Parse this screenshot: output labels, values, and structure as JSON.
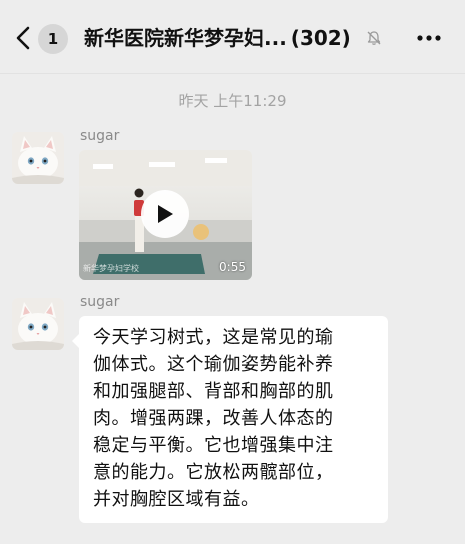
{
  "header": {
    "unread_count": "1",
    "title": "新华医院新华梦孕妇...",
    "member_count": "(302)"
  },
  "timestamp": "昨天 上午11:29",
  "messages": [
    {
      "type": "video",
      "sender": "sugar",
      "duration": "0:55",
      "watermark": "新华梦孕妇学校"
    },
    {
      "type": "text",
      "sender": "sugar",
      "lines": [
        "今天学习树式，这是常见的瑜",
        "伽体式。这个瑜伽姿势能补养",
        "和加强腿部、背部和胸部的肌",
        "肉。增强两踝，改善人体态的",
        "稳定与平衡。它也增强集中注",
        "意的能力。它放松两髋部位，",
        "并对胸腔区域有益。"
      ]
    }
  ],
  "icons": {
    "back": "chevron-left-icon",
    "mute": "bell-muted-icon",
    "more": "more-horizontal-icon",
    "play": "play-icon"
  },
  "colors": {
    "background": "#ededed",
    "bubble": "#ffffff",
    "timestamp": "#a3a3a3",
    "sender": "#8a8a8a"
  }
}
